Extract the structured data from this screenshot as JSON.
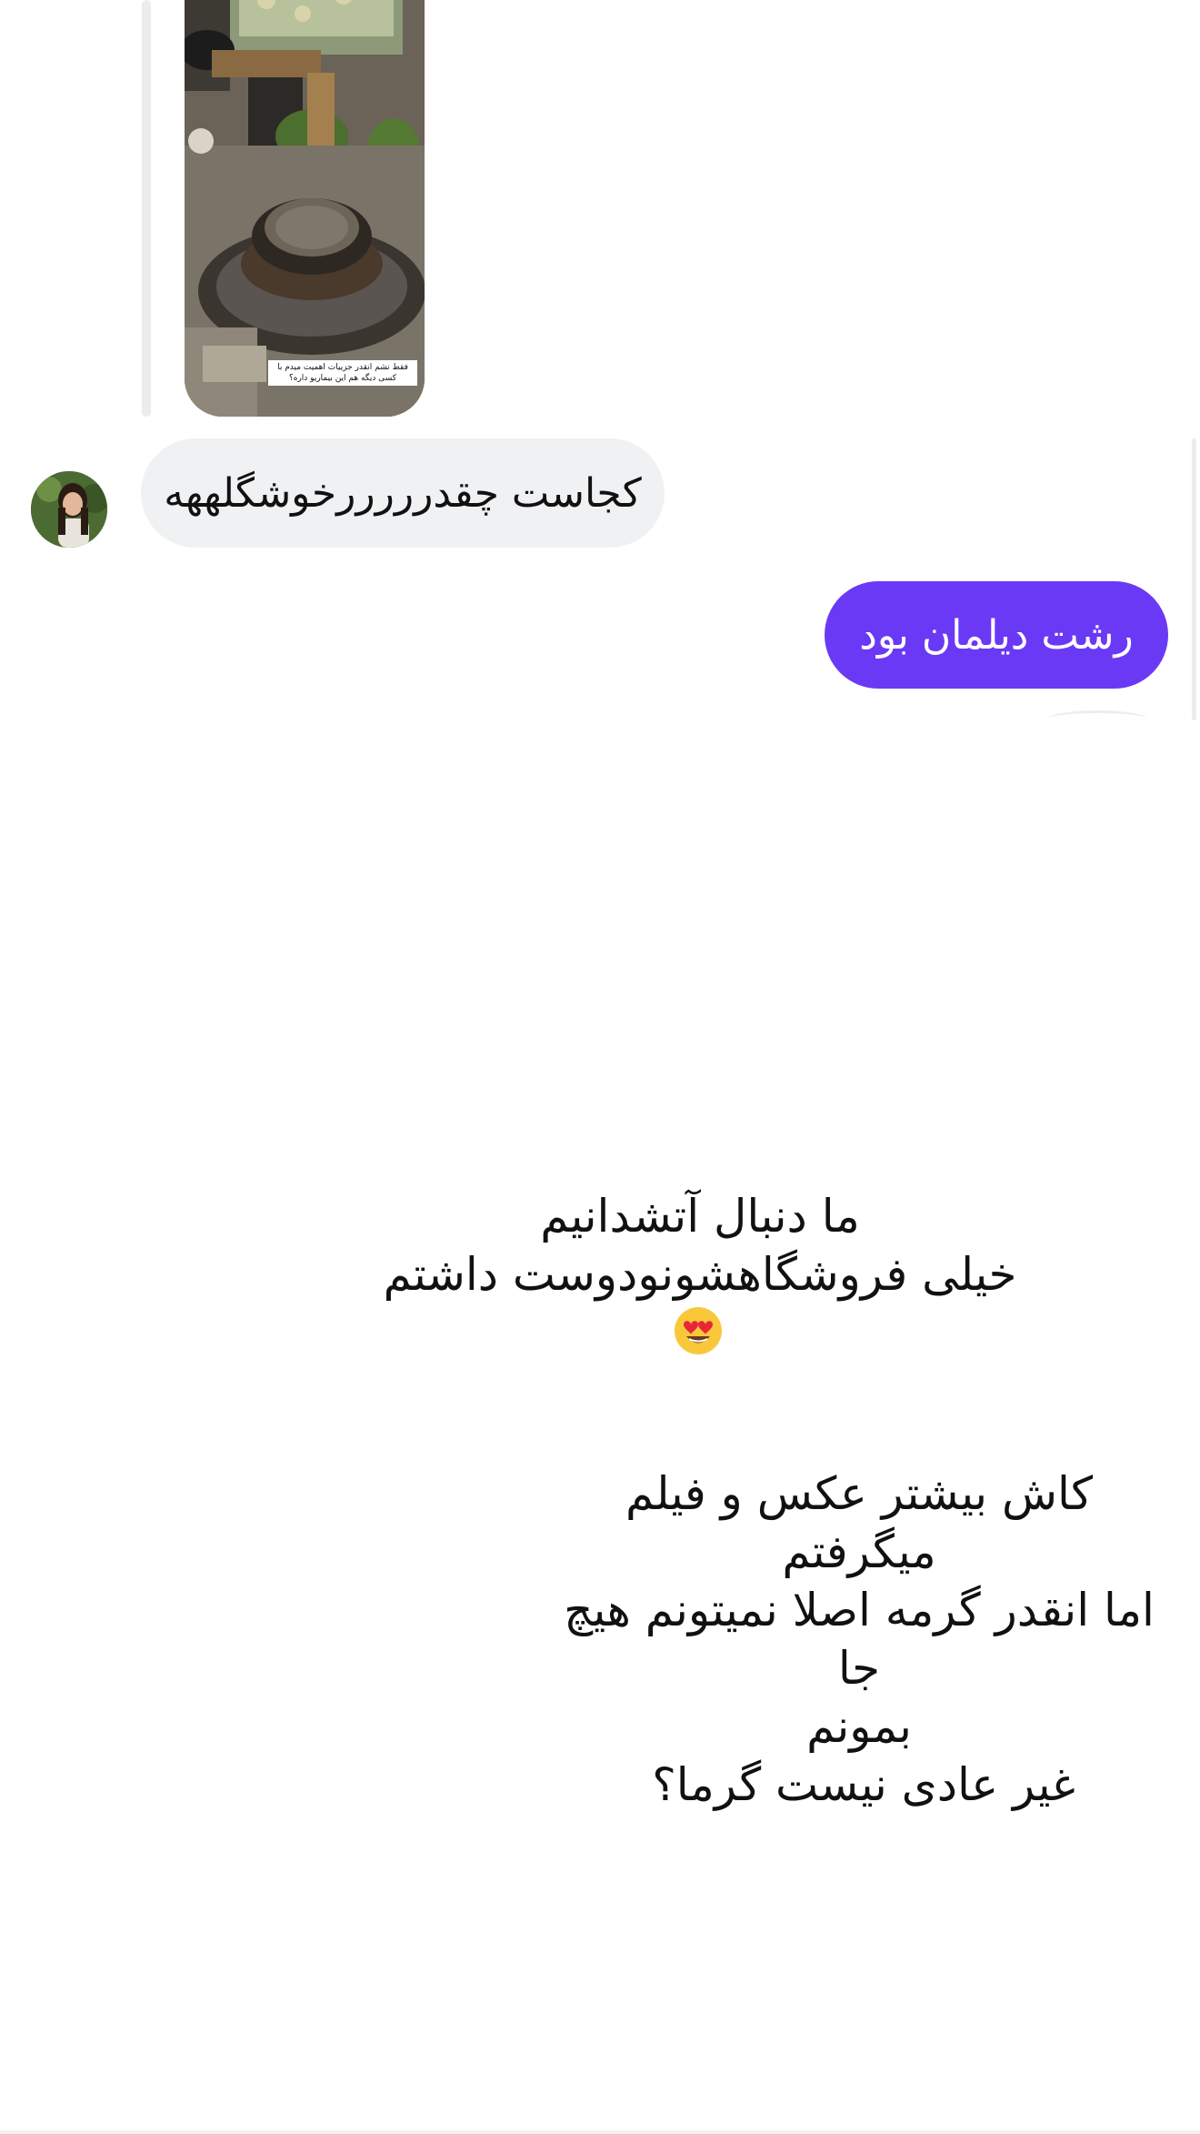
{
  "story_reply": {
    "thumbnail_caption_line1": "فقط نشم انقدر جزییات اهمیت میدم با",
    "thumbnail_caption_line2": "کسی دیگه هم این بیماریو داره؟"
  },
  "messages": {
    "incoming_text": "کجاست چقدرررررخوشگلههه",
    "outgoing_text": "رشت دیلمان بود"
  },
  "story_overlay": {
    "block1_line1": "ما دنبال آتشدانیم",
    "block1_line2": "خیلی فروشگاهشونودوست داشتم",
    "block2_line1": "کاش بیشتر عکس و فیلم میگرفتم",
    "block2_line2": "اما انقدر گرمه اصلا نمیتونم هیچ جا",
    "block2_line3": "بمونم",
    "block3_line1": "غیر عادی نیست گرما؟"
  },
  "icons": {
    "emoji": "heart-eyes-emoji"
  },
  "colors": {
    "outgoing_bubble": "#6a39f5",
    "incoming_bubble": "#f0f1f3"
  }
}
